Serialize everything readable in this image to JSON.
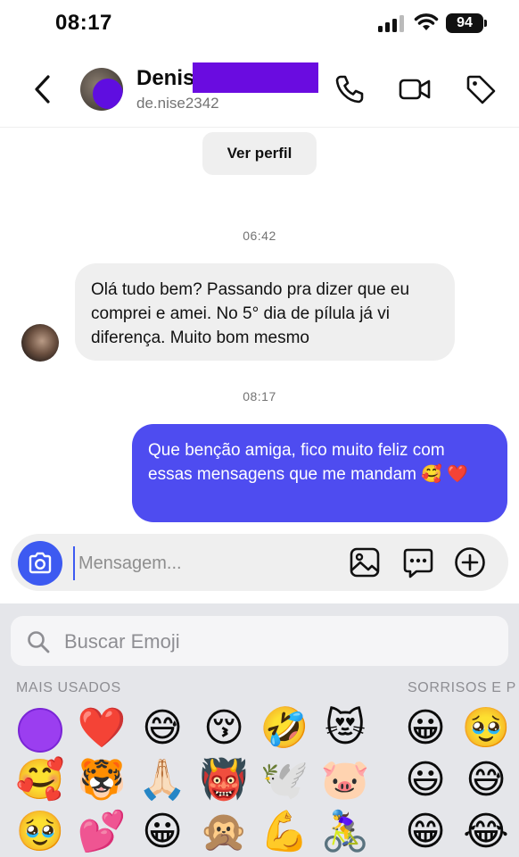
{
  "status_bar": {
    "time": "08:17",
    "battery": "94"
  },
  "header": {
    "name": "Denis",
    "username": "de.nise2342"
  },
  "profile_button": "Ver perfil",
  "messages": [
    {
      "timestamp": "06:42",
      "direction": "in",
      "text": "Olá tudo bem? Passando pra dizer que eu comprei e amei. No 5° dia de pílula já vi diferença. Muito bom mesmo"
    },
    {
      "timestamp": "08:17",
      "direction": "out",
      "text": "Que benção amiga, fico muito feliz com essas mensagens que me mandam 🥰 ❤️"
    }
  ],
  "composer": {
    "placeholder": "Mensagem..."
  },
  "emoji_keyboard": {
    "search_placeholder": "Buscar Emoji",
    "categories": [
      "MAIS USADOS",
      "SORRISOS E P"
    ],
    "frequent": [
      [
        "",
        "❤️",
        "😅",
        "😚",
        "🤣",
        "😻"
      ],
      [
        "🥰",
        "🐯",
        "🙏🏻",
        "👹",
        "🕊️",
        "🐷"
      ],
      [
        "🥹",
        "💕",
        "😀",
        "🙊",
        "💪",
        "🚴‍♀️"
      ]
    ],
    "smileys": [
      [
        "😀",
        "🥹"
      ],
      [
        "😃",
        "😅"
      ],
      [
        "😁",
        "😂"
      ]
    ]
  },
  "colors": {
    "accent": "#4e4cf0",
    "camera_button": "#3d5af1",
    "redaction": "#6a0ce0",
    "incoming_bubble": "#efefef"
  },
  "icons": [
    "back-icon",
    "phone-icon",
    "video-icon",
    "tag-icon",
    "camera-icon",
    "gallery-icon",
    "sticker-icon",
    "plus-icon",
    "search-icon"
  ]
}
